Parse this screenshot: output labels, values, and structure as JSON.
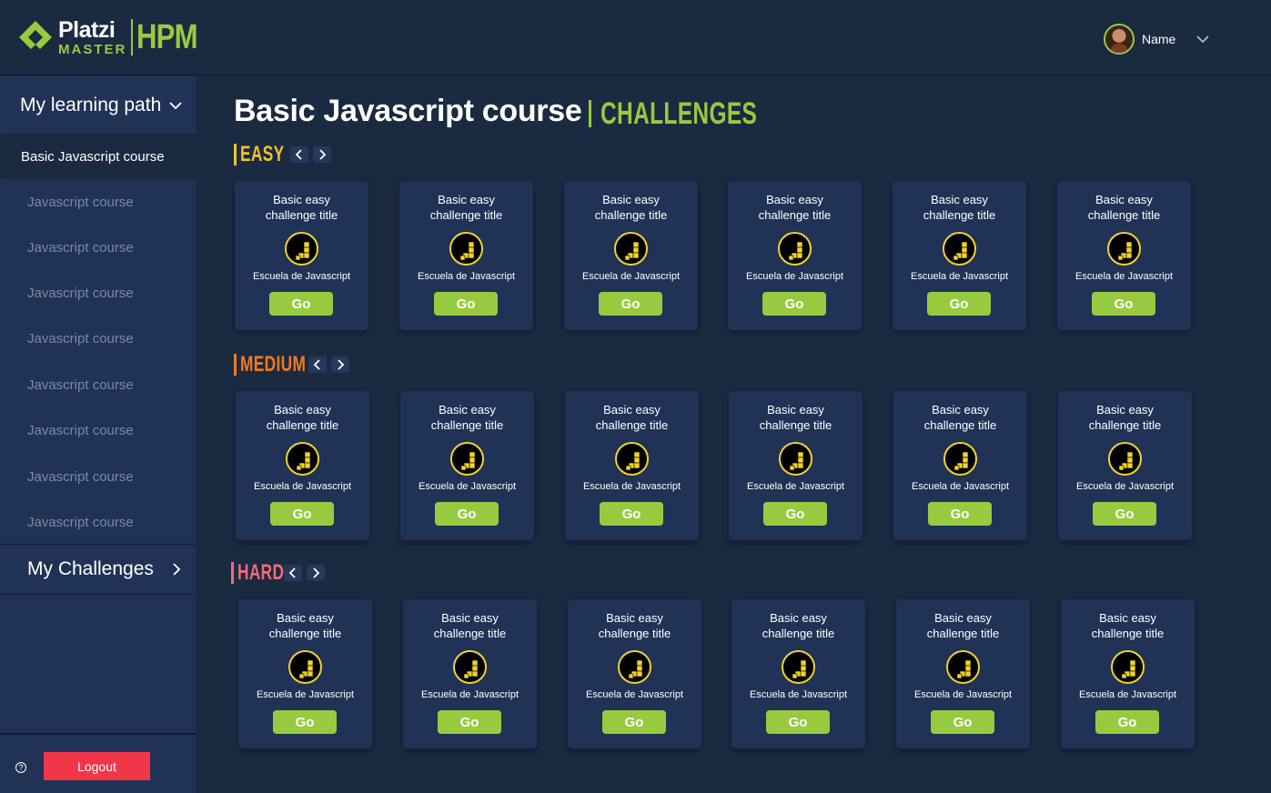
{
  "header": {
    "logo": {
      "brand": "Platzi",
      "sub": "MASTER",
      "product": "HPM"
    },
    "user": {
      "name": "Name"
    }
  },
  "sidebar": {
    "learning_path_label": "My learning path",
    "items": [
      {
        "label": "Basic Javascript course",
        "active": true
      },
      {
        "label": "Javascript course",
        "active": false
      },
      {
        "label": "Javascript course",
        "active": false
      },
      {
        "label": "Javascript course",
        "active": false
      },
      {
        "label": "Javascript course",
        "active": false
      },
      {
        "label": "Javascript course",
        "active": false
      },
      {
        "label": "Javascript course",
        "active": false
      },
      {
        "label": "Javascript course",
        "active": false
      },
      {
        "label": "Javascript course",
        "active": false
      }
    ],
    "challenges_label": "My Challenges",
    "logout_label": "Logout",
    "help_icon": "question-circle-icon"
  },
  "main": {
    "title": "Basic Javascript course",
    "subtitle": "CHALLENGES",
    "sections": [
      {
        "label": "EASY",
        "color": "#f2c230",
        "cards": [
          {
            "title": "Basic easy challenge title",
            "school": "Escuela de Javascript",
            "button": "Go"
          },
          {
            "title": "Basic easy challenge title",
            "school": "Escuela de Javascript",
            "button": "Go"
          },
          {
            "title": "Basic easy challenge title",
            "school": "Escuela de Javascript",
            "button": "Go"
          },
          {
            "title": "Basic easy challenge title",
            "school": "Escuela de Javascript",
            "button": "Go"
          },
          {
            "title": "Basic easy challenge title",
            "school": "Escuela de Javascript",
            "button": "Go"
          },
          {
            "title": "Basic easy challenge title",
            "school": "Escuela de Javascript",
            "button": "Go"
          }
        ]
      },
      {
        "label": "MEDIUM",
        "color": "#f07a22",
        "cards": [
          {
            "title": "Basic easy challenge title",
            "school": "Escuela de Javascript",
            "button": "Go"
          },
          {
            "title": "Basic easy challenge title",
            "school": "Escuela de Javascript",
            "button": "Go"
          },
          {
            "title": "Basic easy challenge title",
            "school": "Escuela de Javascript",
            "button": "Go"
          },
          {
            "title": "Basic easy challenge title",
            "school": "Escuela de Javascript",
            "button": "Go"
          },
          {
            "title": "Basic easy challenge title",
            "school": "Escuela de Javascript",
            "button": "Go"
          },
          {
            "title": "Basic easy challenge title",
            "school": "Escuela de Javascript",
            "button": "Go"
          }
        ]
      },
      {
        "label": "HARD",
        "color": "#f26a7a",
        "cards": [
          {
            "title": "Basic easy challenge title",
            "school": "Escuela de Javascript",
            "button": "Go"
          },
          {
            "title": "Basic easy challenge title",
            "school": "Escuela de Javascript",
            "button": "Go"
          },
          {
            "title": "Basic easy challenge title",
            "school": "Escuela de Javascript",
            "button": "Go"
          },
          {
            "title": "Basic easy challenge title",
            "school": "Escuela de Javascript",
            "button": "Go"
          },
          {
            "title": "Basic easy challenge title",
            "school": "Escuela de Javascript",
            "button": "Go"
          },
          {
            "title": "Basic easy challenge title",
            "school": "Escuela de Javascript",
            "button": "Go"
          }
        ]
      }
    ]
  },
  "colors": {
    "background": "#1a2a40",
    "panel": "#203356",
    "accent_green": "#98ca3f",
    "logout_red": "#f2364a",
    "js_icon_yellow": "#f2d32b"
  }
}
